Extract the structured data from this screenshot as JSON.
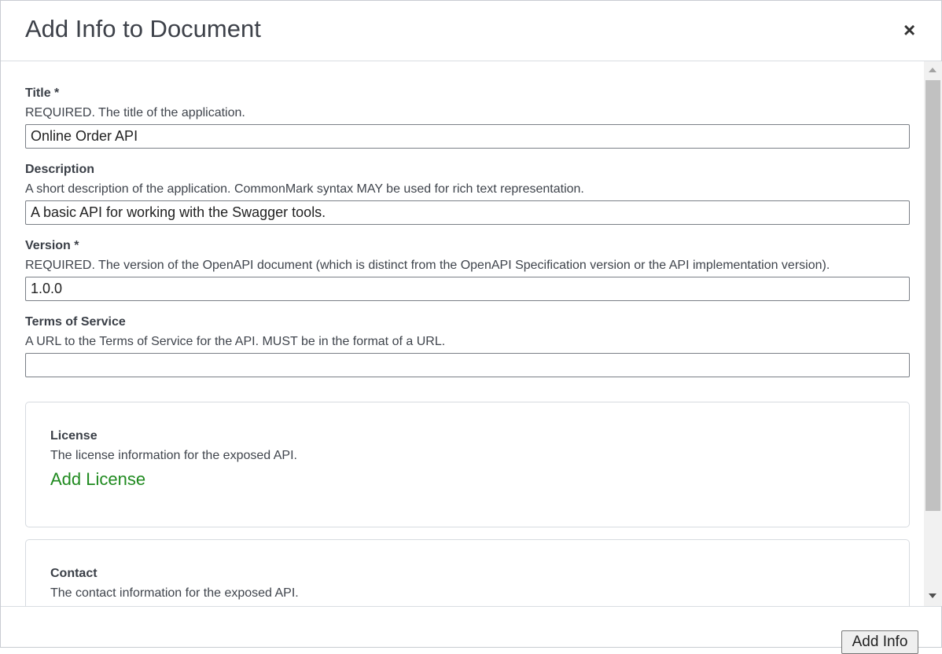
{
  "modal": {
    "title": "Add Info to Document",
    "close_icon": "close-icon",
    "close_glyph": "×"
  },
  "fields": {
    "title": {
      "label": "Title *",
      "description": "REQUIRED. The title of the application.",
      "value": "Online Order API"
    },
    "description": {
      "label": "Description",
      "description": "A short description of the application. CommonMark syntax MAY be used for rich text representation.",
      "value": "A basic API for working with the Swagger tools."
    },
    "version": {
      "label": "Version *",
      "description": "REQUIRED. The version of the OpenAPI document (which is distinct from the OpenAPI Specification version or the API implementation version).",
      "value": "1.0.0"
    },
    "terms_of_service": {
      "label": "Terms of Service",
      "description": "A URL to the Terms of Service for the API. MUST be in the format of a URL.",
      "value": ""
    }
  },
  "license": {
    "label": "License",
    "description": "The license information for the exposed API.",
    "add_link": "Add License"
  },
  "contact": {
    "label": "Contact",
    "description": "The contact information for the exposed API."
  },
  "footer": {
    "add_button": "Add Info"
  },
  "colors": {
    "add_link": "#1f8a1f"
  }
}
